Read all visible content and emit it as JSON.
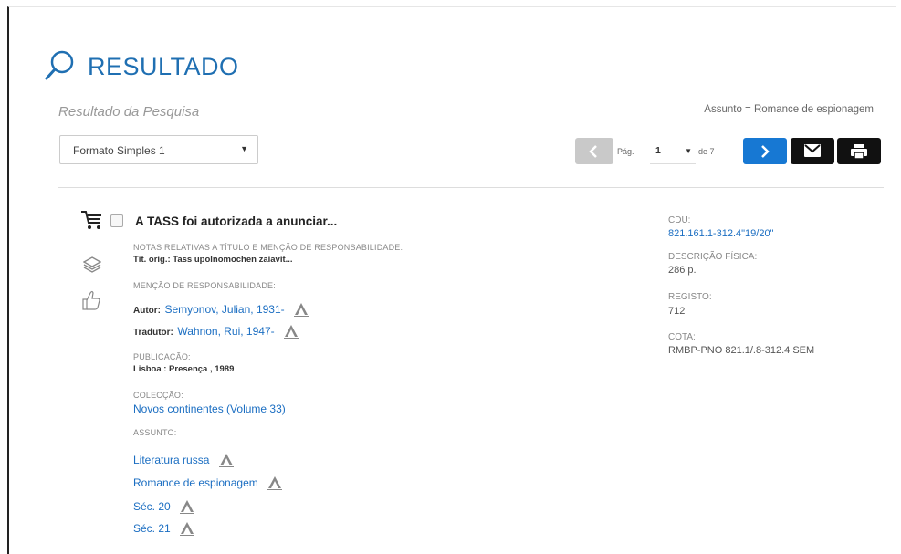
{
  "header": {
    "title": "RESULTADO",
    "subtitle": "Resultado da Pesquisa",
    "query": "Assunto = Romance de espionagem"
  },
  "format": {
    "selected": "Formato Simples 1"
  },
  "pagination": {
    "page_label": "Pág.",
    "current_page": "1",
    "of_label": "de 7"
  },
  "record": {
    "title": "A TASS foi autorizada a anunciar...",
    "notes_label": "NOTAS RELATIVAS A TÍTULO E MENÇÃO DE RESPONSABILIDADE:",
    "notes_value": "Tít. orig.: Tass upolnomochen zaiavit...",
    "responsibility_label": "MENÇÃO DE RESPONSABILIDADE:",
    "author_role": "Autor:",
    "author": "Semyonov, Julian, 1931-",
    "translator_role": "Tradutor:",
    "translator": "Wahnon, Rui, 1947-",
    "publication_label": "PUBLICAÇÃO:",
    "publication": "Lisboa : Presença , 1989",
    "collection_label": "COLECÇÃO:",
    "collection": "Novos continentes (Volume 33)",
    "subject_label": "ASSUNTO:",
    "subjects": [
      "Literatura russa",
      "Romance de espionagem",
      "Séc. 20",
      "Séc. 21"
    ]
  },
  "details": {
    "cdu_label": "CDU:",
    "cdu": "821.161.1-312.4\"19/20\"",
    "physical_label": "DESCRIÇÃO FÍSICA:",
    "physical": "286 p.",
    "registo_label": "REGISTO:",
    "registo": "712",
    "cota_label": "COTA:",
    "cota": "RMBP-PNO 821.1/.8-312.4 SEM"
  },
  "colors": {
    "accent_blue": "#1f6fb2",
    "link_blue": "#1b6ec2",
    "next_button": "#1778d3",
    "dark_button": "#111111"
  }
}
